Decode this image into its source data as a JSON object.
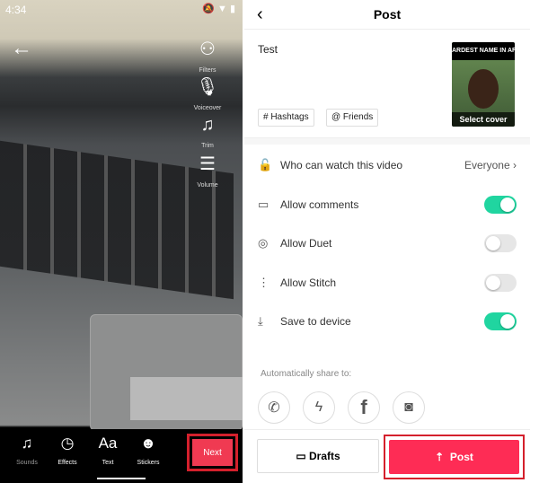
{
  "status": {
    "time": "4:34"
  },
  "editor": {
    "tools": [
      {
        "icon": "filters-icon",
        "label": "Filters"
      },
      {
        "icon": "microphone-icon",
        "label": "Voiceover"
      },
      {
        "icon": "trim-icon",
        "label": "Trim"
      },
      {
        "icon": "volume-icon",
        "label": "Volume"
      }
    ],
    "bottom": [
      {
        "icon": "sounds-icon",
        "label": "Sounds"
      },
      {
        "icon": "effects-icon",
        "label": "Effects"
      },
      {
        "icon": "text-icon",
        "label": "Text",
        "glyph": "Aa"
      },
      {
        "icon": "stickers-icon",
        "label": "Stickers"
      }
    ],
    "next_label": "Next"
  },
  "post": {
    "title": "Post",
    "caption": "Test",
    "cover_text": "ARDEST NAME IN AFRIC",
    "select_cover": "Select cover",
    "hashtags": "# Hashtags",
    "friends": "@ Friends",
    "settings": [
      {
        "label": "Who can watch this video",
        "value": "Everyone"
      },
      {
        "label": "Allow comments",
        "on": true
      },
      {
        "label": "Allow Duet",
        "on": false
      },
      {
        "label": "Allow Stitch",
        "on": false
      },
      {
        "label": "Save to device",
        "on": true
      }
    ],
    "share_label": "Automatically share to:",
    "share": [
      "whatsapp",
      "messenger",
      "facebook",
      "instagram"
    ],
    "drafts": "Drafts",
    "post": "Post"
  },
  "colors": {
    "accent": "#fe2c55",
    "toggle_on": "#20d5a0",
    "highlight": "#d4202c"
  }
}
